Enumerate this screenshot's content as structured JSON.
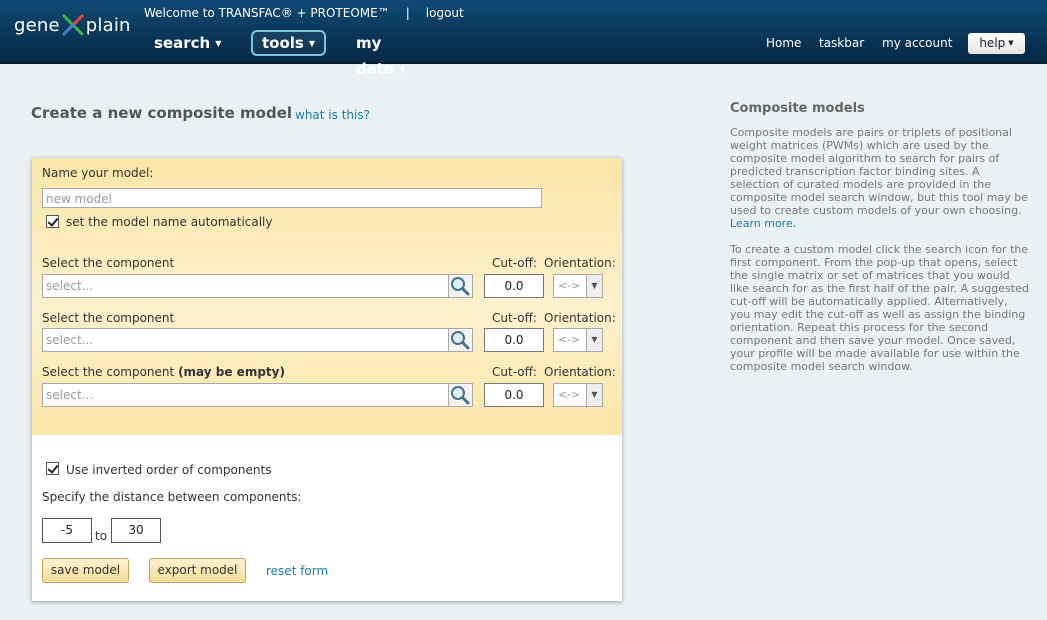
{
  "header": {
    "logo_left": "gene",
    "logo_right": "plain",
    "welcome_text": "Welcome to TRANSFAC® + PROTEOME™",
    "separator": "|",
    "logout": "logout",
    "nav": {
      "search": "search",
      "tools": "tools",
      "mydata": "my data"
    },
    "right_links": {
      "home": "Home",
      "taskbar": "taskbar",
      "account": "my account"
    },
    "help": "help",
    "caret": "▼"
  },
  "main": {
    "title": "Create a new composite model",
    "what_link": "what is this?"
  },
  "form": {
    "name_label": "Name your model:",
    "name_placeholder": "new model",
    "auto_name_label": "set the model name automatically",
    "components": [
      {
        "label": "Select the component",
        "bold_suffix": "",
        "placeholder": "select...",
        "cutoff_label": "Cut-off:",
        "cutoff": "0.0",
        "orientation_label": "Orientation:",
        "orientation": "<->"
      },
      {
        "label": "Select the component",
        "bold_suffix": "",
        "placeholder": "select...",
        "cutoff_label": "Cut-off:",
        "cutoff": "0.0",
        "orientation_label": "Orientation:",
        "orientation": "<->"
      },
      {
        "label": "Select the component",
        "bold_suffix": "(may be empty)",
        "placeholder": "select...",
        "cutoff_label": "Cut-off:",
        "cutoff": "0.0",
        "orientation_label": "Orientation:",
        "orientation": "<->"
      }
    ],
    "inverted_label": "Use inverted order of components",
    "distance_label": "Specify the distance between components:",
    "distance_from": "-5",
    "to_label": "to",
    "distance_to": "30",
    "save": "save model",
    "export": "export model",
    "reset": "reset form"
  },
  "sidebar": {
    "title": "Composite models",
    "para1": "Composite models are pairs or triplets of positional weight matrices (PWMs) which are used by the composite model algorithm to search for pairs of predicted transcription factor binding sites. A selection of curated models are provided in the composite model search window, but this tool may be used to create custom models of your own choosing.",
    "learn_more": "Learn more.",
    "para2": "To create a custom model click the search icon for the first component. From the pop-up that opens, select the single matrix or set of matrices that you would like search for as the first half of the pair. A suggested cut-off will be automatically applied. Alternatively, you may edit the cut-off as well as assign the binding orientation. Repeat this process for the second component and then save your model. Once saved, your profile will be made available for use within the composite model search window."
  },
  "colors": {
    "header_dark": "#0a3557",
    "form_top": "#fbe6a8",
    "link": "#1f7aa0",
    "button": "#f8dc96"
  }
}
